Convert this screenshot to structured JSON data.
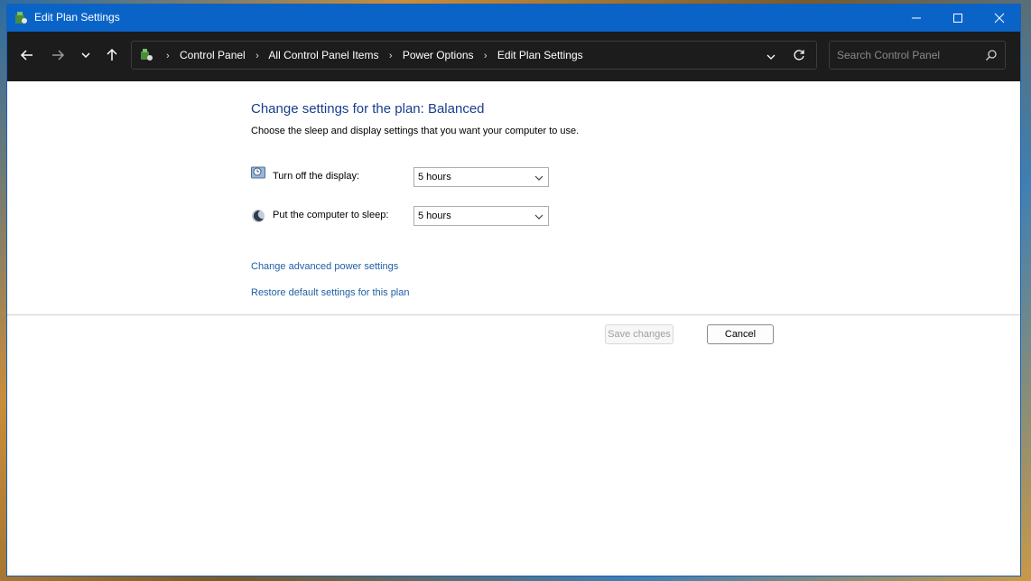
{
  "window": {
    "title": "Edit Plan Settings",
    "accent": "#0a64c8"
  },
  "titlebar": {
    "minimize_icon": "minimize-icon",
    "maximize_icon": "maximize-icon",
    "close_icon": "close-icon"
  },
  "nav": {
    "back_icon": "arrow-left-icon",
    "forward_icon": "arrow-right-icon",
    "recent_icon": "chevron-down-icon",
    "up_icon": "arrow-up-icon"
  },
  "address": {
    "crumbs": [
      "Control Panel",
      "All Control Panel Items",
      "Power Options",
      "Edit Plan Settings"
    ]
  },
  "search": {
    "placeholder": "Search Control Panel"
  },
  "main": {
    "heading": "Change settings for the plan: Balanced",
    "subheading": "Choose the sleep and display settings that you want your computer to use.",
    "display_label": "Turn off the display:",
    "display_value": "5 hours",
    "sleep_label": "Put the computer to sleep:",
    "sleep_value": "5 hours",
    "advanced_link": "Change advanced power settings",
    "restore_link": "Restore default settings for this plan",
    "save_label": "Save changes",
    "cancel_label": "Cancel"
  },
  "colors": {
    "link": "#1d5fa6",
    "heading": "#1a3e8c"
  }
}
